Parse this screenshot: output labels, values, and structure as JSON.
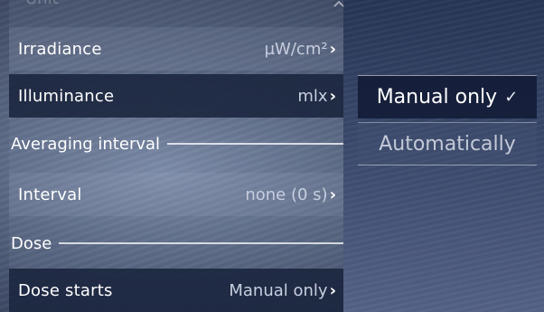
{
  "header": {
    "partial_title": "Unit",
    "collapse_icon": "chevron-up-icon"
  },
  "rows": [
    {
      "label": "Irradiance",
      "value": "µW/cm²",
      "chevron": "›"
    },
    {
      "label": "Illuminance",
      "value": "mlx",
      "chevron": "›"
    }
  ],
  "averaging": {
    "section_title": "Averaging interval"
  },
  "interval": {
    "label": "Interval",
    "value": "none (0 s)",
    "chevron": "›"
  },
  "dose": {
    "section_title": "Dose",
    "starts_label": "Dose starts",
    "starts_value": "Manual only",
    "chevron": "›"
  },
  "dropdown": {
    "options": [
      {
        "label": "Manual only",
        "selected": true,
        "check": "✓"
      },
      {
        "label": "Automatically",
        "selected": false
      }
    ]
  },
  "colors": {
    "selected_bg": "#141c37",
    "panel_text": "#ffffff"
  }
}
